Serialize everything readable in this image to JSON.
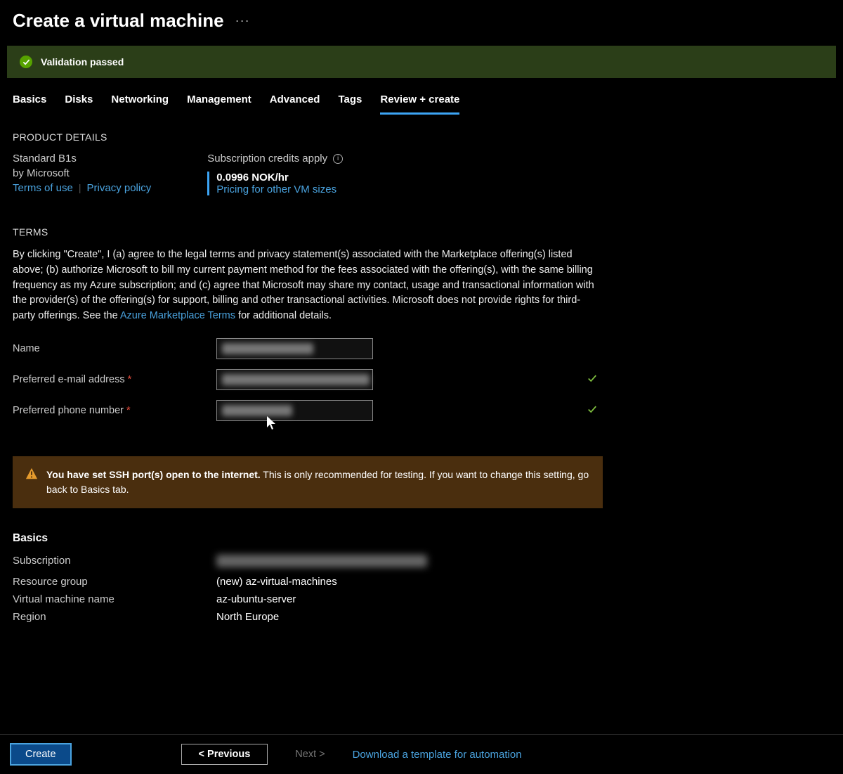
{
  "header": {
    "title": "Create a virtual machine",
    "more": "···"
  },
  "validation": {
    "text": "Validation passed"
  },
  "tabs": {
    "items": [
      {
        "label": "Basics"
      },
      {
        "label": "Disks"
      },
      {
        "label": "Networking"
      },
      {
        "label": "Management"
      },
      {
        "label": "Advanced"
      },
      {
        "label": "Tags"
      },
      {
        "label": "Review + create"
      }
    ],
    "activeIndex": 6
  },
  "productDetails": {
    "header": "PRODUCT DETAILS",
    "name": "Standard B1s",
    "by": "by Microsoft",
    "termsLink": "Terms of use",
    "privacyLink": "Privacy policy",
    "creditsLabel": "Subscription credits apply",
    "price": "0.0996 NOK/hr",
    "pricingLink": "Pricing for other VM sizes"
  },
  "terms": {
    "header": "TERMS",
    "bodyPrefix": "By clicking \"Create\", I (a) agree to the legal terms and privacy statement(s) associated with the Marketplace offering(s) listed above; (b) authorize Microsoft to bill my current payment method for the fees associated with the offering(s), with the same billing frequency as my Azure subscription; and (c) agree that Microsoft may share my contact, usage and transactional information with the provider(s) of the offering(s) for support, billing and other transactional activities. Microsoft does not provide rights for third-party offerings. See the ",
    "linkText": "Azure Marketplace Terms",
    "bodySuffix": " for additional details."
  },
  "form": {
    "nameLabel": "Name",
    "emailLabel": "Preferred e-mail address",
    "phoneLabel": "Preferred phone number",
    "requiredMark": "*"
  },
  "warning": {
    "bold": "You have set SSH port(s) open to the internet.",
    "rest": "  This is only recommended for testing.  If you want to change this setting, go back to Basics tab."
  },
  "basics": {
    "header": "Basics",
    "rows": [
      {
        "label": "Subscription",
        "value": ""
      },
      {
        "label": "Resource group",
        "value": "(new) az-virtual-machines"
      },
      {
        "label": "Virtual machine name",
        "value": "az-ubuntu-server"
      },
      {
        "label": "Region",
        "value": "North Europe"
      }
    ]
  },
  "footer": {
    "create": "Create",
    "previous": "< Previous",
    "next": "Next >",
    "downloadLink": "Download a template for automation"
  }
}
